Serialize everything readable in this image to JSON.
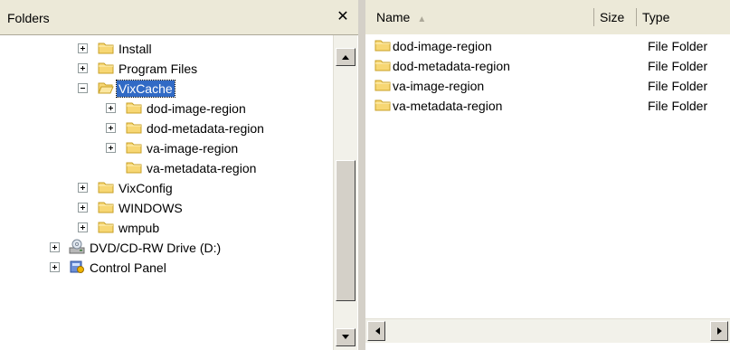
{
  "folders": {
    "title": "Folders",
    "close_symbol": "✕",
    "tree": [
      {
        "label": "Install",
        "expander": "plus"
      },
      {
        "label": "Program Files",
        "expander": "plus"
      },
      {
        "label": "VixCache",
        "expander": "minus",
        "selected": true
      },
      {
        "label": "dod-image-region",
        "expander": "plus"
      },
      {
        "label": "dod-metadata-region",
        "expander": "plus"
      },
      {
        "label": "va-image-region",
        "expander": "plus"
      },
      {
        "label": "va-metadata-region",
        "expander": "none"
      },
      {
        "label": "VixConfig",
        "expander": "plus"
      },
      {
        "label": "WINDOWS",
        "expander": "plus"
      },
      {
        "label": "wmpub",
        "expander": "plus"
      },
      {
        "label": "DVD/CD-RW Drive (D:)",
        "expander": "plus",
        "icon": "dvd-drive-icon"
      },
      {
        "label": "Control Panel",
        "expander": "plus",
        "icon": "control-panel-icon"
      }
    ]
  },
  "columns": {
    "name": "Name",
    "size": "Size",
    "type": "Type"
  },
  "files": [
    {
      "name": "dod-image-region",
      "size": "",
      "type": "File Folder"
    },
    {
      "name": "dod-metadata-region",
      "size": "",
      "type": "File Folder"
    },
    {
      "name": "va-image-region",
      "size": "",
      "type": "File Folder"
    },
    {
      "name": "va-metadata-region",
      "size": "",
      "type": "File Folder"
    }
  ],
  "colors": {
    "selection": "#316ac5",
    "folder_yellow": "#f7d774"
  }
}
